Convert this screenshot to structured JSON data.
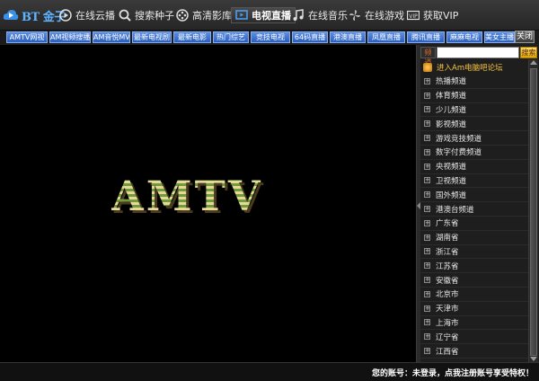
{
  "app": {
    "logo_text": "BT 金子"
  },
  "nav": {
    "items": [
      {
        "label": "在线云播",
        "icon": "play-circle-icon"
      },
      {
        "label": "搜索种子",
        "icon": "search-icon"
      },
      {
        "label": "高清影库",
        "icon": "film-reel-icon"
      },
      {
        "label": "电视直播",
        "icon": "tv-play-icon"
      },
      {
        "label": "在线音乐",
        "icon": "music-note-icon"
      },
      {
        "label": "在线游戏",
        "icon": "pinwheel-icon"
      },
      {
        "label": "获取VIP",
        "icon": "vip-icon"
      }
    ]
  },
  "tabs": [
    "AMTV网视",
    "AM视频搜播",
    "AM音悦MV",
    "最新电视剧",
    "最新电影",
    "热门综艺",
    "竞技电视",
    "64码直播",
    "港澳直播",
    "凤凰直播",
    "腾讯直播",
    "麻麻电视",
    "美女主播"
  ],
  "video": {
    "logo_text": "AMTV"
  },
  "panel": {
    "search_label": "频道",
    "search_placeholder": "",
    "search_button": "搜索",
    "close_button": "关闭",
    "forum_link": "进入Am电脑吧论坛",
    "channels": [
      "热播频道",
      "体育频道",
      "少儿频道",
      "影视频道",
      "游戏竞技频道",
      "数字付费频道",
      "央视频道",
      "卫视频道",
      "国外频道",
      "港澳台频道",
      "广东省",
      "湖南省",
      "浙江省",
      "江苏省",
      "安徽省",
      "北京市",
      "天津市",
      "上海市",
      "辽宁省",
      "江西省"
    ]
  },
  "status": {
    "account_text": "您的账号：未登录，点我注册账号享受特权！"
  },
  "colors": {
    "tab_blue": "#2a5fbf",
    "forum_orange": "#f5c242",
    "accent_blue": "#5fb3ff"
  }
}
